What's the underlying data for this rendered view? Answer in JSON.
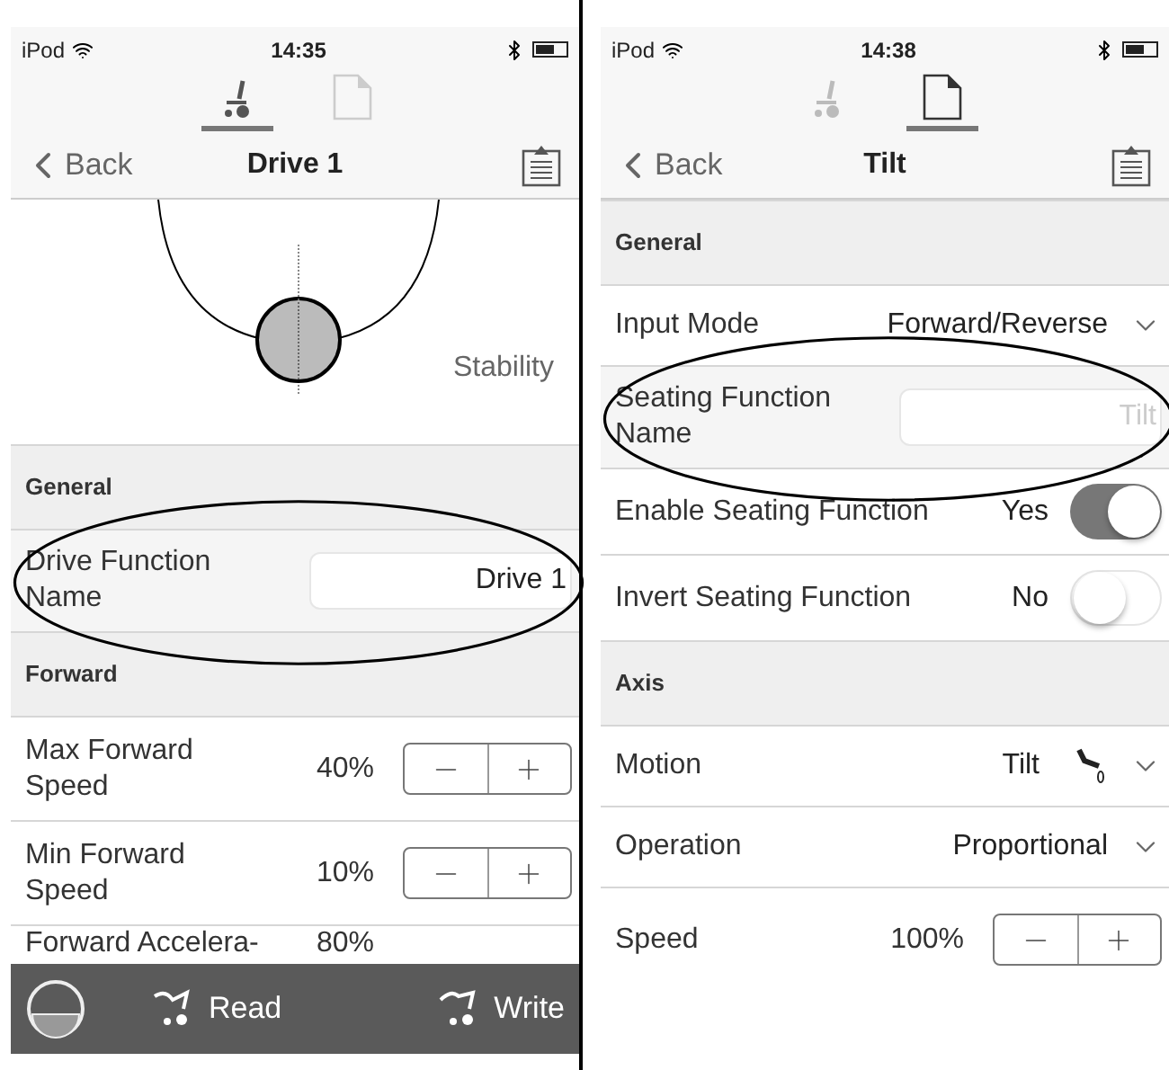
{
  "panels": [
    {
      "status": {
        "carrier": "iPod",
        "time": "14:35"
      },
      "tabs": [
        {
          "kind": "drive",
          "selected": true
        },
        {
          "kind": "document",
          "selected": false
        }
      ],
      "nav": {
        "back": "Back",
        "title": "Drive 1"
      },
      "diagram": {
        "label": "Stability"
      },
      "sections": [
        {
          "title": "General",
          "rows": [
            {
              "kind": "text_field",
              "label": "Drive Function Name",
              "value": "Drive 1",
              "annotated": true
            }
          ]
        },
        {
          "title": "Forward",
          "rows": [
            {
              "kind": "stepper",
              "label": "Max Forward Speed",
              "value": "40%",
              "annotated": false
            },
            {
              "kind": "stepper",
              "label": "Min Forward Speed",
              "value": "10%",
              "annotated": false
            },
            {
              "kind": "partial",
              "label": "Forward Accelera-",
              "value": "80%",
              "annotated": false
            }
          ]
        }
      ],
      "toolbar": {
        "read": "Read",
        "write": "Write"
      }
    },
    {
      "status": {
        "carrier": "iPod",
        "time": "14:38"
      },
      "tabs": [
        {
          "kind": "drive",
          "selected": false
        },
        {
          "kind": "document",
          "selected": true
        }
      ],
      "nav": {
        "back": "Back",
        "title": "Tilt"
      },
      "sections": [
        {
          "title": "General",
          "rows": [
            {
              "kind": "dropdown",
              "label": "Input Mode",
              "value": "Forward/Reverse",
              "annotated": false
            },
            {
              "kind": "text_field",
              "label": "Seating Function Name",
              "placeholder": "Tilt",
              "annotated": true
            },
            {
              "kind": "toggle",
              "label": "Enable Seating Function",
              "value": "Yes",
              "on": true,
              "annotated": false
            },
            {
              "kind": "toggle",
              "label": "Invert Seating Function",
              "value": "No",
              "on": false,
              "annotated": false
            }
          ]
        },
        {
          "title": "Axis",
          "rows": [
            {
              "kind": "dropdown_icon",
              "label": "Motion",
              "value": "Tilt",
              "annotated": false
            },
            {
              "kind": "dropdown",
              "label": "Operation",
              "value": "Proportional",
              "annotated": false
            },
            {
              "kind": "stepper",
              "label": "Speed",
              "value": "100%",
              "annotated": false
            }
          ]
        }
      ]
    }
  ]
}
